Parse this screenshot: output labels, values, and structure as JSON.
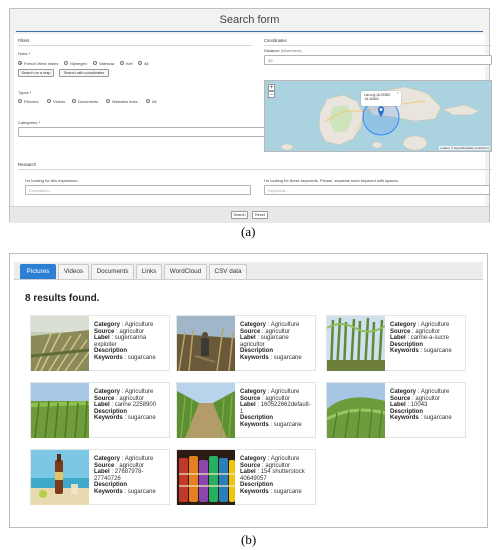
{
  "figure_a": {
    "caption": "(a)",
    "title": "Search form",
    "filters_heading": "Filters",
    "hubs_label": "Hubs",
    "hubs_required_mark": "*",
    "hubs": [
      {
        "label": "French West Indies",
        "checked": true
      },
      {
        "label": "Nijmegen",
        "checked": false
      },
      {
        "label": "Valencia",
        "checked": false
      },
      {
        "label": "Kiel",
        "checked": false
      },
      {
        "label": "All",
        "checked": false
      }
    ],
    "search_map_button": "Search on a map",
    "search_coords_button": "Search with coordinates",
    "types_label": "Types",
    "types_required_mark": "*",
    "types": [
      {
        "label": "Pictures",
        "checked": false
      },
      {
        "label": "Videos",
        "checked": false
      },
      {
        "label": "Documents",
        "checked": false
      },
      {
        "label": "Websites links",
        "checked": false
      },
      {
        "label": "All",
        "checked": false
      }
    ],
    "categories_label": "Categories",
    "categories_required_mark": "*",
    "coordinates_heading": "Coordinates",
    "distance_label": "Distance",
    "distance_unit": "(kilometers)",
    "distance_value": "20",
    "map": {
      "zoom_in": "+",
      "zoom_out": "−",
      "popup_line1": "Lat-Lng:16.29389,",
      "popup_line2": "-61.60662",
      "popup_close": "×",
      "attribution": "Leaflet | © OpenStreetMap contributors",
      "sea_color": "#abd3df",
      "land_color": "#e9e5dc",
      "circle_color": "#3388ff"
    },
    "research_heading": "Research",
    "expression_label": "I'm looking for this expression.",
    "expression_placeholder": "Expression...",
    "keywords_label": "I'm looking for these keywords. Please, separate each keyword with spaces.",
    "keywords_placeholder": "Keywords...",
    "search_button": "Search",
    "reset_button": "Reset"
  },
  "figure_b": {
    "caption": "(b)",
    "tabs": [
      {
        "label": "Pictures",
        "active": true
      },
      {
        "label": "Videos",
        "active": false
      },
      {
        "label": "Documents",
        "active": false
      },
      {
        "label": "Links",
        "active": false
      },
      {
        "label": "WordCloud",
        "active": false
      },
      {
        "label": "CSV data",
        "active": false
      }
    ],
    "result_count_text": "8 results found.",
    "field_labels": {
      "category": "Category",
      "source": "Source",
      "label": "Label",
      "description": "Description",
      "keywords": "Keywords"
    },
    "separator": " : ",
    "results": [
      {
        "category": "Agriculture",
        "source": "agricultor",
        "label": "sugercanna exploiter",
        "description": "",
        "keywords": "sugarcane",
        "thumb": "harvest"
      },
      {
        "category": "Agriculture",
        "source": "agricultor",
        "label": "sugarcane agricultor",
        "description": "",
        "keywords": "sugarcane",
        "thumb": "worker"
      },
      {
        "category": "Agriculture",
        "source": "agricultor",
        "label": "canne-a-sucre",
        "description": "",
        "keywords": "sugarcane",
        "thumb": "tall-cane"
      },
      {
        "category": "Agriculture",
        "source": "agricultor",
        "label": "canne 2258900",
        "description": "",
        "keywords": "sugarcane",
        "thumb": "field"
      },
      {
        "category": "Agriculture",
        "source": "agricultor",
        "label": "160522662default-1",
        "description": "",
        "keywords": "sugarcane",
        "thumb": "path"
      },
      {
        "category": "Agriculture",
        "source": "agricultor",
        "label": "10043",
        "description": "",
        "keywords": "sugarcane",
        "thumb": "hill-field"
      },
      {
        "category": "Agriculture",
        "source": "agricultor",
        "label": "27687978-27740726",
        "description": "",
        "keywords": "sugarcane",
        "thumb": "rum-beach"
      },
      {
        "category": "Agriculture",
        "source": "agricultor",
        "label": "154 shutterstock 40649057",
        "description": "",
        "keywords": "sugarcane",
        "thumb": "rum-bottles"
      }
    ]
  }
}
